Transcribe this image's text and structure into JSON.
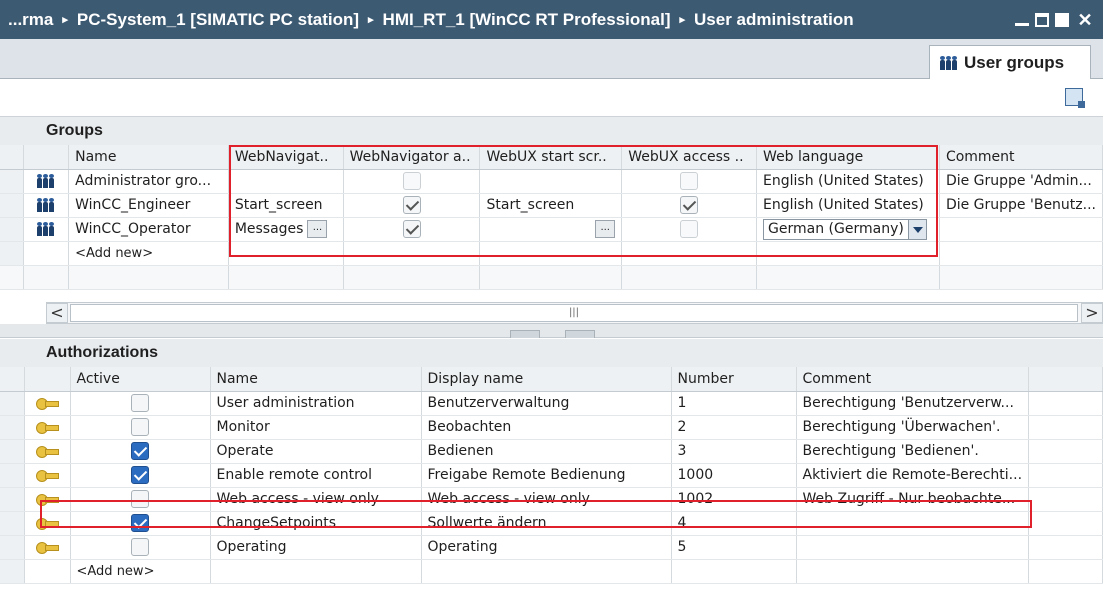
{
  "titlebar": {
    "breadcrumbs": [
      "...rma",
      "PC-System_1 [SIMATIC PC station]",
      "HMI_RT_1 [WinCC RT Professional]",
      "User administration"
    ],
    "separator": "▸"
  },
  "tabs": {
    "active": "User groups"
  },
  "groups": {
    "title": "Groups",
    "columns": [
      "Name",
      "WebNavigat..",
      "WebNavigator a..",
      "WebUX start scr..",
      "WebUX access ..",
      "Web language",
      "Comment"
    ],
    "rows": [
      {
        "name": "Administrator gro...",
        "webnav_start": "",
        "webnav_access": false,
        "webux_start": "",
        "webux_access": false,
        "web_language": "English (United States)",
        "comment": "Die Gruppe 'Admin..."
      },
      {
        "name": "WinCC_Engineer",
        "webnav_start": "Start_screen",
        "webnav_access": true,
        "webux_start": "Start_screen",
        "webux_access": true,
        "web_language": "English (United States)",
        "comment": "Die Gruppe 'Benutz..."
      },
      {
        "name": "WinCC_Operator",
        "webnav_start": "Messages",
        "webnav_access": true,
        "webux_start": "",
        "webux_access": false,
        "web_language": "German (Germany)",
        "comment": ""
      }
    ],
    "add_new": "<Add new>",
    "ellipsis": "...",
    "scroll_grip": "|||",
    "scroll_left": "<",
    "scroll_right": ">"
  },
  "authorizations": {
    "title": "Authorizations",
    "columns": [
      "Active",
      "Name",
      "Display name",
      "Number",
      "Comment"
    ],
    "rows": [
      {
        "active": false,
        "name": "User administration",
        "display": "Benutzerverwaltung",
        "number": "1",
        "comment": "Berechtigung 'Benutzerverw..."
      },
      {
        "active": false,
        "name": "Monitor",
        "display": "Beobachten",
        "number": "2",
        "comment": "Berechtigung 'Überwachen'."
      },
      {
        "active": true,
        "name": "Operate",
        "display": "Bedienen",
        "number": "3",
        "comment": "Berechtigung 'Bedienen'."
      },
      {
        "active": true,
        "name": "Enable remote control",
        "display": "Freigabe Remote Bedienung",
        "number": "1000",
        "comment": "Aktiviert die Remote-Berechti..."
      },
      {
        "active": false,
        "name": "Web access - view only",
        "display": "Web access - view only",
        "number": "1002",
        "comment": "Web Zugriff - Nur beobachte..."
      },
      {
        "active": true,
        "name": "ChangeSetpoints",
        "display": "Sollwerte ändern",
        "number": "4",
        "comment": ""
      },
      {
        "active": false,
        "name": "Operating",
        "display": "Operating",
        "number": "5",
        "comment": ""
      }
    ],
    "add_new": "<Add new>"
  },
  "colors": {
    "titlebar": "#3d5a73",
    "highlight_box": "#e0202a",
    "checkbox_active": "#2c6cc0"
  }
}
